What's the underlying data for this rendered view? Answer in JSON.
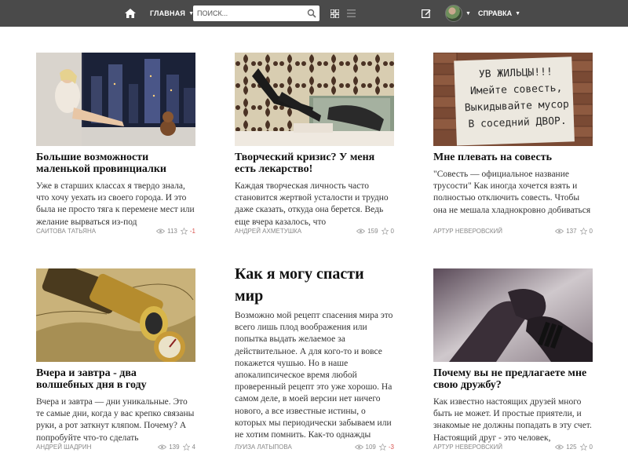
{
  "header": {
    "nav_main_label": "ГЛАВНАЯ",
    "search_placeholder": "ПОИСК...",
    "help_label": "СПРАВКА",
    "bg_color": "#4a4a4a"
  },
  "posts": [
    {
      "title": "Большие возможности маленькой провинциалки",
      "excerpt": "Уже в старших классах я твердо знала, что хочу уехать из своего города. И это была не просто тяга к перемене мест или желание вырваться из-под",
      "author": "САИТОВА ТАТЬЯНА",
      "views": "113",
      "rating": "-1",
      "rating_negative": true
    },
    {
      "title": "Творческий кризис? У меня есть лекарство!",
      "excerpt": "Каждая творческая личность часто становится жертвой усталости и трудно даже сказать, откуда она берется. Ведь еще вчера казалось, что",
      "author": "АНДРЕЙ АХМЕТУШКА",
      "views": "159",
      "rating": "0",
      "rating_negative": false
    },
    {
      "title": "Мне плевать на совесть",
      "excerpt": "\"Совесть — официальное название трусости\" Как иногда хочется взять и полностью отключить совесть. Чтобы она не мешала хладнокровно добиваться поставленных результатов.",
      "author": "АРТУР НЕВЕРОВСКИЙ",
      "views": "137",
      "rating": "0",
      "rating_negative": false,
      "image_note_lines": [
        "УВ ЖИЛЬЦЫ!!!",
        "Имейте совесть,",
        "Выкидывайте мусор",
        "В соседний ДВОР."
      ]
    },
    {
      "title": "Вчера и завтра - два волшебных дня в году",
      "excerpt": "Вчера и завтра — дни уникальные. Это те самые дни, когда у вас крепко связаны руки, а рот заткнут кляпом. Почему? А попробуйте что-то сделать",
      "author": "АНДРЕЙ ШАДРИН",
      "views": "139",
      "rating": "4",
      "rating_negative": false
    },
    {
      "title": "Как я могу спасти мир",
      "excerpt": "Возможно мой рецепт спасения мира это всего лишь плод воображения или попытка выдать желаемое за действительное. А для кого-то и вовсе покажется чушью. Но в наше апокалипсическое время любой проверенный рецепт это уже хорошо. На самом деле, в моей версии нет ничего нового, а все известные истины, о которых мы периодически забываем или не хотим помнить. Как-то однажды вечером, выйдя на улицу, я",
      "author": "ЛУИЗА ЛАТЫПОВА",
      "views": "109",
      "rating": "-3",
      "rating_negative": true
    },
    {
      "title": "Почему вы не предлагаете мне свою дружбу?",
      "excerpt": "Как известно настоящих друзей много быть не может. И простые приятели, и знакомые не должны попадать в эту счет. Настоящий друг - это человек,",
      "author": "АРТУР НЕВЕРОВСКИЙ",
      "views": "125",
      "rating": "0",
      "rating_negative": false
    }
  ]
}
